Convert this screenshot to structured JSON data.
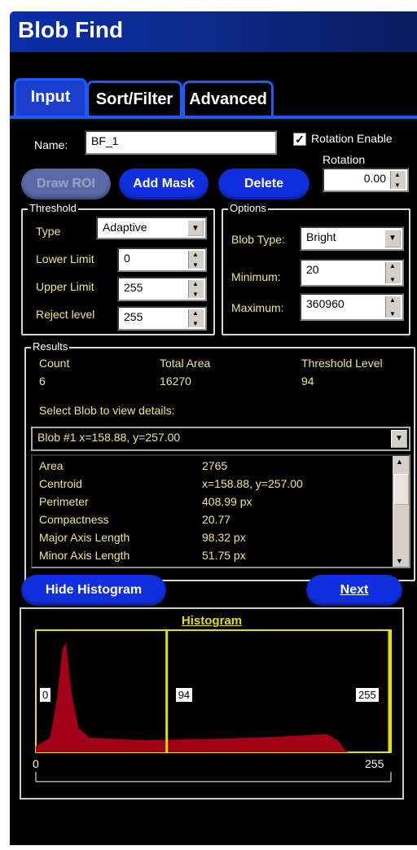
{
  "window": {
    "title": "Blob Find"
  },
  "tabs": [
    {
      "label": "Input"
    },
    {
      "label": "Sort/Filter"
    },
    {
      "label": "Advanced"
    }
  ],
  "name_field": {
    "label": "Name:",
    "value": "BF_1"
  },
  "rotation": {
    "enable_label": "Rotation Enable",
    "enabled": true,
    "label": "Rotation",
    "value": "0.00"
  },
  "buttons": {
    "draw_roi": "Draw ROI",
    "add_mask": "Add Mask",
    "delete": "Delete",
    "hide_histogram": "Hide Histogram",
    "next": "Next"
  },
  "threshold": {
    "title": "Threshold",
    "type_label": "Type",
    "type_value": "Adaptive",
    "lower_label": "Lower Limit",
    "lower_value": "0",
    "upper_label": "Upper Limit",
    "upper_value": "255",
    "reject_label": "Reject level",
    "reject_value": "255"
  },
  "options": {
    "title": "Options",
    "blob_type_label": "Blob Type:",
    "blob_type_value": "Bright",
    "minimum_label": "Minimum:",
    "minimum_value": "20",
    "maximum_label": "Maximum:",
    "maximum_value": "360960"
  },
  "results": {
    "title": "Results",
    "count_label": "Count",
    "count_value": "6",
    "area_label": "Total Area",
    "area_value": "16270",
    "threshold_label": "Threshold Level",
    "threshold_value": "94",
    "select_label": "Select Blob to view details:",
    "selected_blob": "Blob #1   x=158.88, y=257.00",
    "details": [
      {
        "k": "Area",
        "v": "2765"
      },
      {
        "k": "Centroid",
        "v": "x=158.88, y=257.00"
      },
      {
        "k": "Perimeter",
        "v": "408.99 px"
      },
      {
        "k": "Compactness",
        "v": "20.77"
      },
      {
        "k": "Major Axis Length",
        "v": "98.32 px"
      },
      {
        "k": "Minor Axis Length",
        "v": "51.75 px"
      }
    ]
  },
  "histogram": {
    "title": "Histogram",
    "lower_marker": "0",
    "threshold_marker": "94",
    "upper_marker": "255",
    "axis_min": "0",
    "axis_max": "255",
    "threshold_fraction": 0.3686,
    "fill_color": "#a00018",
    "marker_color": "#e8e000"
  },
  "colors": {
    "accent": "#1a5cff",
    "label_text": "#f0e68c"
  }
}
